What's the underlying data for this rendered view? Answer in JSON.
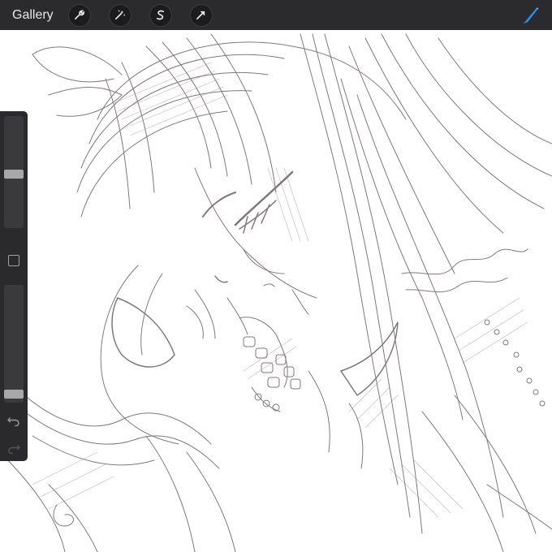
{
  "topbar": {
    "gallery_label": "Gallery",
    "tools": [
      {
        "icon": "wrench-icon"
      },
      {
        "icon": "magic-wand-icon"
      },
      {
        "icon": "selection-s-icon"
      },
      {
        "icon": "transform-arrow-icon"
      }
    ],
    "active_tool": {
      "icon": "brush-icon",
      "color": "#2d8cf0"
    }
  },
  "sidebar": {
    "brush_size_level": 0.48,
    "brush_opacity_level": 0.04,
    "modify_icon": "square-icon",
    "undo_icon": "undo-arrow-icon",
    "redo_icon": "redo-arrow-icon"
  },
  "canvas": {
    "subject": "pencil-sketch",
    "line_color": "#6a6266"
  }
}
